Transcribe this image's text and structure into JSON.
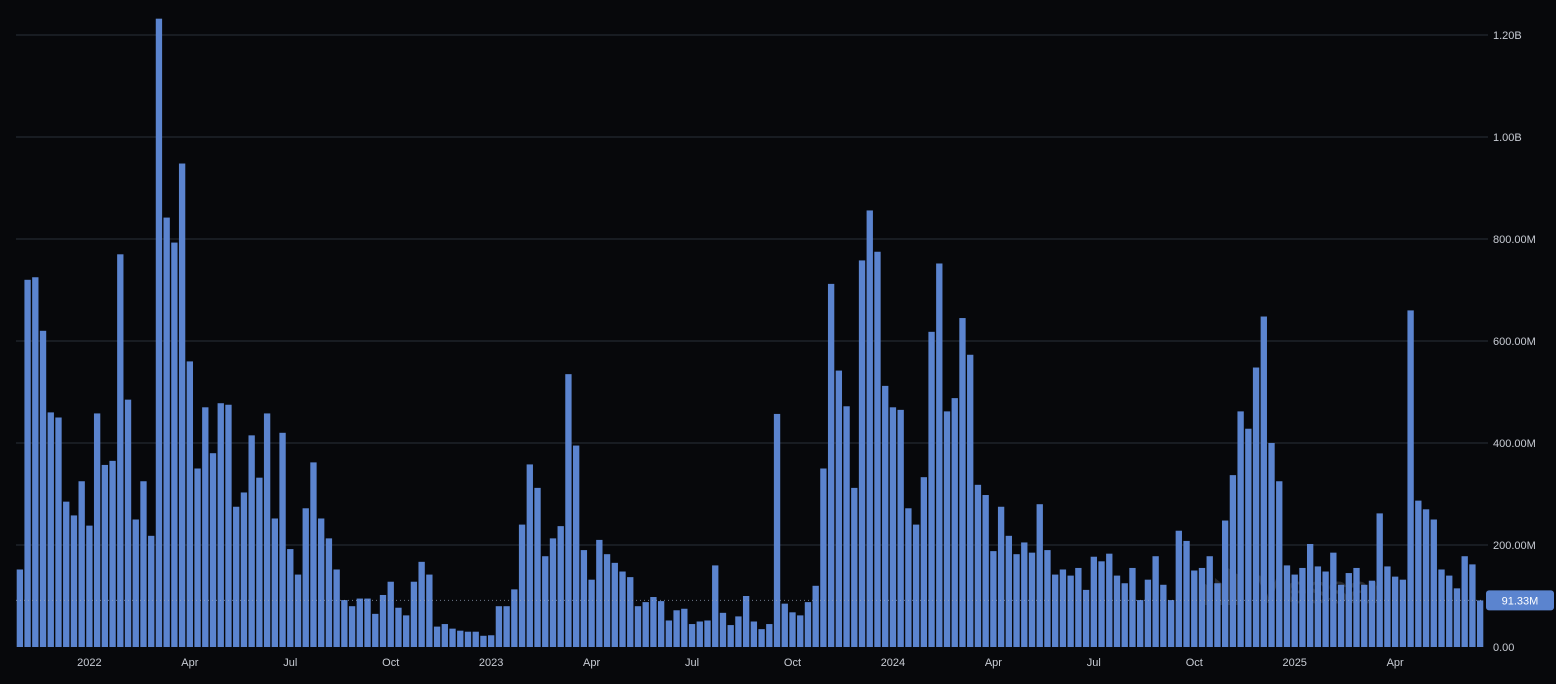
{
  "colors": {
    "background": "#07080b",
    "bar": "#5b84cf",
    "gridline": "#2a3038",
    "axis_text": "#c8ccd4",
    "last_value_badge": "#5b84cf",
    "last_value_text": "#ffffff",
    "watermark": "#ffffff"
  },
  "watermark": {
    "text": "Messari",
    "logo_icon": "messari-logo-icon"
  },
  "chart_data": {
    "type": "bar",
    "title": "",
    "xlabel": "",
    "ylabel": "",
    "ylim": [
      0,
      1200000000
    ],
    "grid": true,
    "y_axis_position": "right",
    "y_ticks": [
      {
        "value": 0,
        "label": "0.00"
      },
      {
        "value": 200000000,
        "label": "200.00M"
      },
      {
        "value": 400000000,
        "label": "400.00M"
      },
      {
        "value": 600000000,
        "label": "600.00M"
      },
      {
        "value": 800000000,
        "label": "800.00M"
      },
      {
        "value": 1000000000,
        "label": "1.00B"
      },
      {
        "value": 1200000000,
        "label": "1.20B"
      }
    ],
    "x_ticks": [
      {
        "index": 9,
        "label": "2022"
      },
      {
        "index": 22,
        "label": "Apr"
      },
      {
        "index": 35,
        "label": "Jul"
      },
      {
        "index": 48,
        "label": "Oct"
      },
      {
        "index": 61,
        "label": "2023"
      },
      {
        "index": 74,
        "label": "Apr"
      },
      {
        "index": 87,
        "label": "Jul"
      },
      {
        "index": 100,
        "label": "Oct"
      },
      {
        "index": 113,
        "label": "2024"
      },
      {
        "index": 126,
        "label": "Apr"
      },
      {
        "index": 139,
        "label": "Jul"
      },
      {
        "index": 152,
        "label": "Oct"
      },
      {
        "index": 165,
        "label": "2025"
      },
      {
        "index": 178,
        "label": "Apr"
      }
    ],
    "last_value": {
      "value": 91330000,
      "label": "91.33M"
    },
    "series": [
      {
        "values": [
          152000000,
          720000000,
          725000000,
          620000000,
          460000000,
          450000000,
          285000000,
          258000000,
          325000000,
          238000000,
          458000000,
          357000000,
          365000000,
          770000000,
          485000000,
          250000000,
          325000000,
          218000000,
          1232000000,
          842000000,
          793000000,
          948000000,
          560000000,
          350000000,
          470000000,
          380000000,
          478000000,
          475000000,
          275000000,
          303000000,
          415000000,
          332000000,
          458000000,
          252000000,
          420000000,
          192000000,
          142000000,
          272000000,
          362000000,
          252000000,
          213000000,
          152000000,
          92000000,
          80000000,
          95000000,
          95000000,
          65000000,
          102000000,
          128000000,
          77000000,
          62000000,
          128000000,
          167000000,
          142000000,
          40000000,
          45000000,
          36000000,
          32000000,
          30000000,
          30000000,
          22000000,
          23000000,
          80000000,
          80000000,
          113000000,
          240000000,
          358000000,
          312000000,
          178000000,
          213000000,
          237000000,
          535000000,
          395000000,
          190000000,
          132000000,
          210000000,
          182000000,
          165000000,
          148000000,
          137000000,
          80000000,
          88000000,
          98000000,
          90000000,
          52000000,
          72000000,
          75000000,
          45000000,
          50000000,
          52000000,
          160000000,
          67000000,
          43000000,
          60000000,
          100000000,
          50000000,
          35000000,
          45000000,
          457000000,
          85000000,
          68000000,
          62000000,
          88000000,
          120000000,
          350000000,
          712000000,
          542000000,
          472000000,
          312000000,
          758000000,
          856000000,
          775000000,
          512000000,
          470000000,
          465000000,
          272000000,
          240000000,
          333000000,
          618000000,
          752000000,
          462000000,
          488000000,
          645000000,
          573000000,
          318000000,
          298000000,
          188000000,
          275000000,
          218000000,
          182000000,
          205000000,
          185000000,
          280000000,
          190000000,
          142000000,
          152000000,
          140000000,
          155000000,
          112000000,
          177000000,
          168000000,
          183000000,
          140000000,
          125000000,
          155000000,
          92000000,
          132000000,
          178000000,
          122000000,
          92000000,
          228000000,
          208000000,
          150000000,
          155000000,
          178000000,
          125000000,
          248000000,
          337000000,
          462000000,
          428000000,
          548000000,
          648000000,
          400000000,
          325000000,
          160000000,
          142000000,
          155000000,
          202000000,
          158000000,
          148000000,
          185000000,
          122000000,
          145000000,
          155000000,
          122000000,
          130000000,
          262000000,
          158000000,
          138000000,
          132000000,
          660000000,
          287000000,
          270000000,
          250000000,
          152000000,
          140000000,
          115000000,
          178000000,
          162000000,
          91330000
        ]
      }
    ]
  }
}
